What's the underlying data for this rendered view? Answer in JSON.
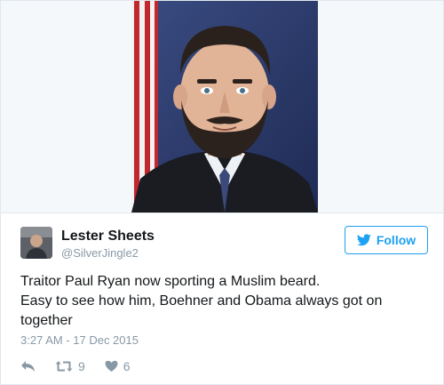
{
  "tweet": {
    "author": {
      "name": "Lester Sheets",
      "handle": "@SilverJingle2"
    },
    "follow_label": "Follow",
    "text_lines": [
      "Traitor Paul Ryan now sporting a Muslim beard.",
      "Easy to see how him, Boehner and Obama always got on",
      "together"
    ],
    "timestamp": "3:27 AM - 17 Dec 2015",
    "retweet_count": "9",
    "like_count": "6"
  },
  "icons": {
    "follow": "twitter-bird-icon",
    "reply": "reply-icon",
    "retweet": "retweet-icon",
    "like": "heart-icon"
  },
  "colors": {
    "accent": "#1da1f2",
    "muted": "#8899a6",
    "text": "#14171a",
    "border": "#e1e8ed"
  }
}
